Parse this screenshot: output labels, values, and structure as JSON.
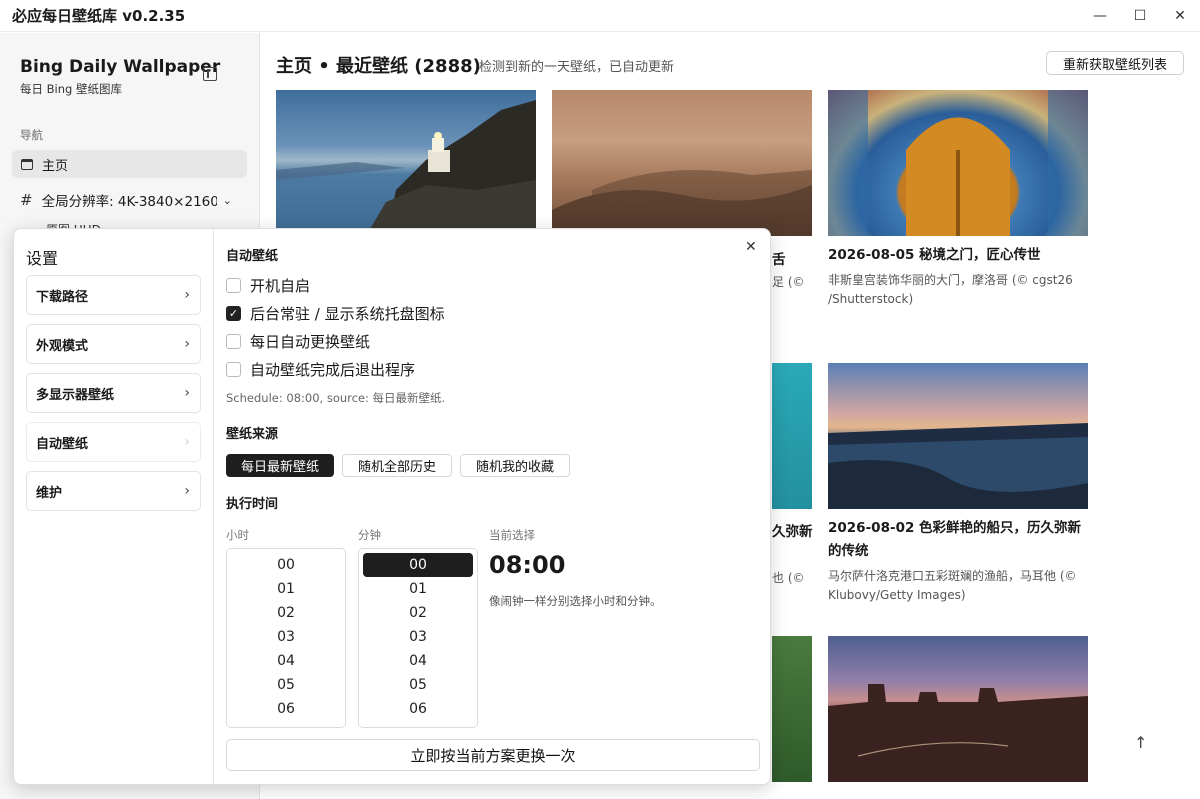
{
  "window": {
    "title": "必应每日壁纸库 v0.2.35",
    "controls": {
      "minimize": "—",
      "maximize": "☐",
      "close": "✕"
    }
  },
  "sidebar": {
    "app_name": "Bing Daily Wallpaper",
    "app_subtitle": "每日 Bing 壁纸图库",
    "nav_label": "导航",
    "home_label": "主页",
    "resolution_icon": "#",
    "resolution_label": "全局分辨率: 4K-3840×2160",
    "hud_label": "原图 UHD"
  },
  "main": {
    "title": "主页 • 最近壁纸 (2888)",
    "status": "检测到新的一天壁纸，已自动更新",
    "refresh_label": "重新获取壁纸列表",
    "cards": [
      {
        "title": "2026-08-05 秘境之门，匠心传世",
        "desc_line1": "非斯皇宫装饰华丽的大门，摩洛哥 (© cgst26",
        "desc_line2": "/Shutterstock)"
      },
      {
        "title_line1": "2026-08-02 色彩鲜艳的船只，历久弥新",
        "title_line2": "的传统",
        "desc_line1": "马尔萨什洛克港口五彩斑斓的渔船，马耳他 (©",
        "desc_line2": "Klubovy/Getty Images)"
      }
    ],
    "fragments": {
      "a": "舌",
      "b": "足 (©",
      "c": "久弥新",
      "d": "也 (©"
    },
    "scroll_top_icon": "↑"
  },
  "settings": {
    "title": "设置",
    "menu": [
      {
        "label": "下载路径"
      },
      {
        "label": "外观模式"
      },
      {
        "label": "多显示器壁纸"
      },
      {
        "label": "自动壁纸"
      },
      {
        "label": "维护"
      }
    ],
    "close_icon": "✕",
    "auto_section": "自动壁纸",
    "checkboxes": [
      {
        "label": "开机自启",
        "checked": false
      },
      {
        "label": "后台常驻 / 显示系统托盘图标",
        "checked": true
      },
      {
        "label": "每日自动更换壁纸",
        "checked": false
      },
      {
        "label": "自动壁纸完成后退出程序",
        "checked": false
      }
    ],
    "schedule_hint": "Schedule: 08:00, source: 每日最新壁纸.",
    "source_section": "壁纸来源",
    "sources": [
      "每日最新壁纸",
      "随机全部历史",
      "随机我的收藏"
    ],
    "time_section": "执行时间",
    "hour_label": "小时",
    "minute_label": "分钟",
    "hours": [
      "00",
      "01",
      "02",
      "03",
      "04",
      "05",
      "06"
    ],
    "minutes": [
      "00",
      "01",
      "02",
      "03",
      "04",
      "05",
      "06"
    ],
    "current_label": "当前选择",
    "current_value": "08:00",
    "current_hint": "像闹钟一样分别选择小时和分钟。",
    "apply_label": "立即按当前方案更换一次"
  }
}
